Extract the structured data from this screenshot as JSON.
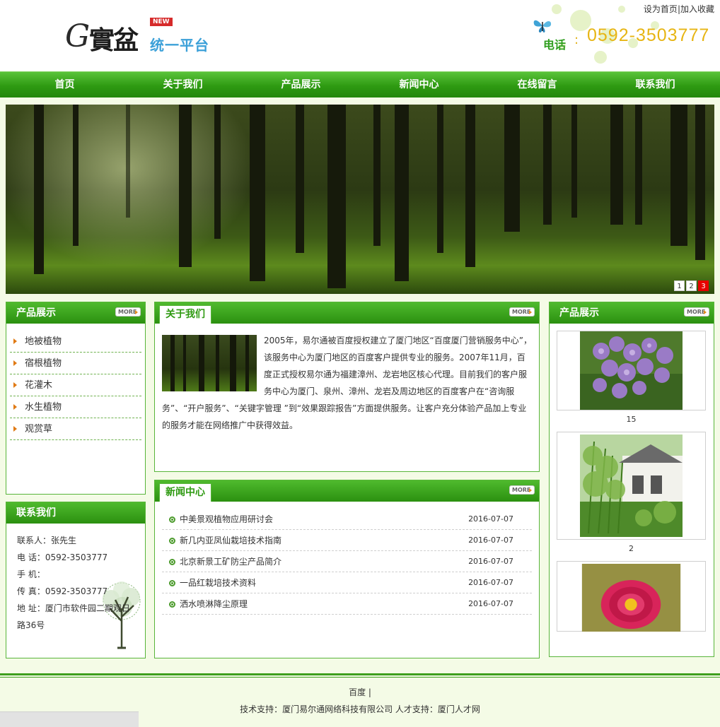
{
  "header": {
    "logo_g": "G",
    "logo_name": "實盆",
    "logo_badge": "NEW",
    "logo_subtitle": "统一平台",
    "set_home": "设为首页",
    "separator": "|",
    "bookmark": "加入收藏",
    "phone_label": "电话",
    "phone_colon": ":",
    "phone_number": "0592-3503777"
  },
  "nav": {
    "items": [
      "首页",
      "关于我们",
      "产品展示",
      "新闻中心",
      "在线留言",
      "联系我们"
    ]
  },
  "banner": {
    "pager": [
      "1",
      "2",
      "3"
    ],
    "active_page": 3
  },
  "left_products": {
    "title": "产品展示",
    "more": "MORE",
    "items": [
      "地被植物",
      "宿根植物",
      "花灌木",
      "水生植物",
      "观赏草"
    ]
  },
  "contact": {
    "title": "联系我们",
    "person": "联系人：张先生",
    "phone": "电  话：0592-3503777",
    "mobile": "手  机：",
    "fax": "传  真：0592-3503777",
    "address": "地  址：厦门市软件园二期观日路36号"
  },
  "about": {
    "title": "关于我们",
    "more": "MORE",
    "text": "2005年，易尔通被百度授权建立了厦门地区“百度厦门营销服务中心”，该服务中心为厦门地区的百度客户提供专业的服务。2007年11月，百度正式授权易尔通为福建漳州、龙岩地区核心代理。目前我们的客户服务中心为厦门、泉州、漳州、龙岩及周边地区的百度客户在“咨询服务”、“开户服务”、“关键字管理 ”到“效果跟踪报告”方面提供服务。让客户充分体验产品加上专业的服务才能在网络推广中获得效益。"
  },
  "news": {
    "title": "新闻中心",
    "more": "MORE",
    "items": [
      {
        "title": "中美景观植物应用研讨会",
        "date": "2016-07-07"
      },
      {
        "title": "新几内亚凤仙栽培技术指南",
        "date": "2016-07-07"
      },
      {
        "title": "北京新景工矿防尘产品简介",
        "date": "2016-07-07"
      },
      {
        "title": "一品红栽培技术资料",
        "date": "2016-07-07"
      },
      {
        "title": "洒水喷淋降尘原理",
        "date": "2016-07-07"
      }
    ]
  },
  "right_products": {
    "title": "产品展示",
    "more": "MORE",
    "items": [
      {
        "caption": "15"
      },
      {
        "caption": "2"
      },
      {
        "caption": ""
      }
    ]
  },
  "footer": {
    "nav": "百度 |",
    "copyright": "技术支持：厦门易尔通网络科技有限公司 人才支持：厦门人才网"
  },
  "colors": {
    "nav_green": "#2e9a12",
    "panel_border": "#58b53a",
    "phone_yellow": "#e7b514",
    "pager_active": "#e60000",
    "bullet_orange": "#e07a14"
  }
}
